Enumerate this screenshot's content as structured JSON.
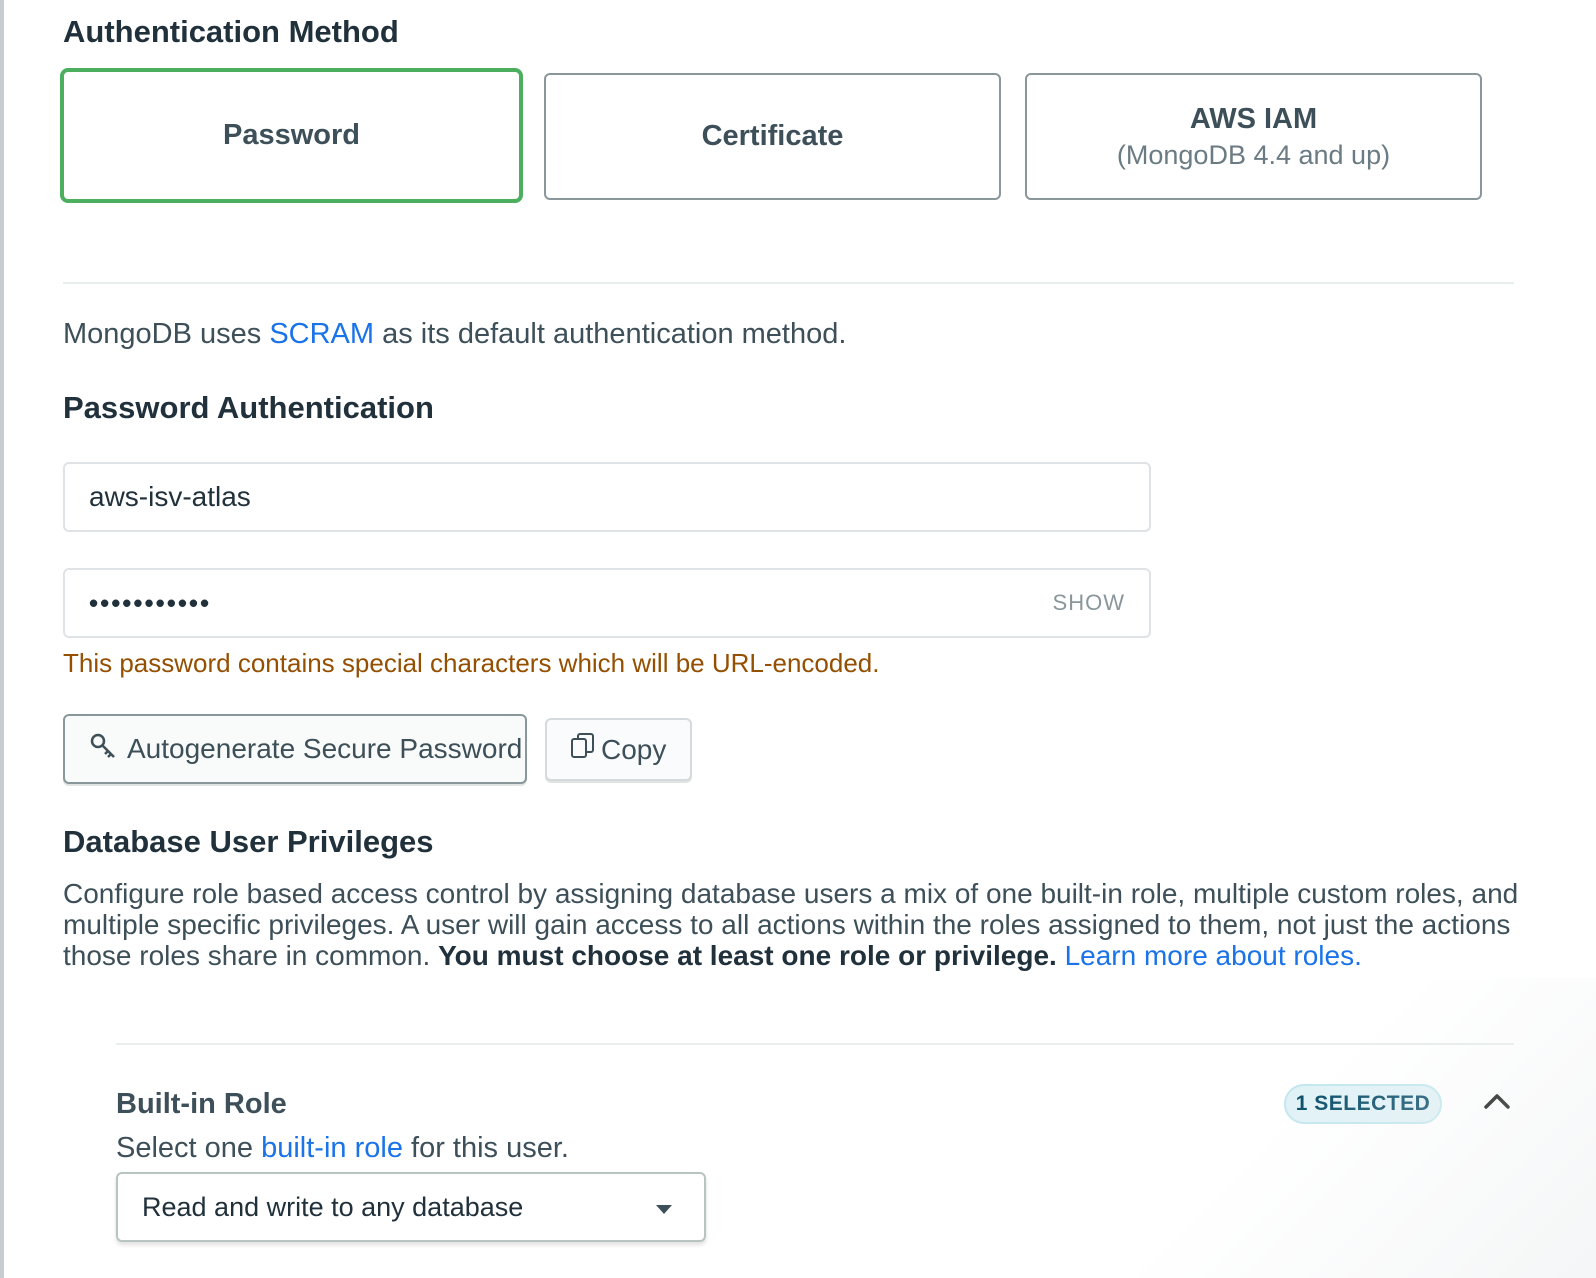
{
  "auth_method": {
    "heading": "Authentication Method",
    "options": [
      {
        "title": "Password",
        "sub": ""
      },
      {
        "title": "Certificate",
        "sub": ""
      },
      {
        "title": "AWS IAM",
        "sub": "(MongoDB 4.4 and up)"
      }
    ],
    "selected": "Password"
  },
  "scram_note": {
    "prefix": "MongoDB uses ",
    "link": "SCRAM",
    "suffix": " as its default authentication method."
  },
  "password_auth": {
    "heading": "Password Authentication",
    "username": "aws-isv-atlas",
    "password_mask": "•••••••••••",
    "show_label": "SHOW",
    "warning": "This password contains special characters which will be URL-encoded.",
    "autogenerate_label": "Autogenerate Secure Password",
    "copy_label": "Copy"
  },
  "privileges": {
    "heading": "Database User Privileges",
    "text": "Configure role based access control by assigning database users a mix of one built-in role, multiple custom roles, and multiple specific privileges. A user will gain access to all actions within the roles assigned to them, not just the actions those roles share in common. ",
    "bold": "You must choose at least one role or privilege.",
    "link": "Learn more about roles."
  },
  "builtin_role": {
    "heading": "Built-in Role",
    "badge": "1 SELECTED",
    "desc_prefix": "Select one ",
    "desc_link": "built-in role",
    "desc_suffix": " for this user.",
    "selected_value": "Read and write to any database"
  },
  "colors": {
    "selected_border": "#4caf60",
    "link": "#1a73e8",
    "warning": "#944f01",
    "badge_bg": "#e1f2f6"
  }
}
